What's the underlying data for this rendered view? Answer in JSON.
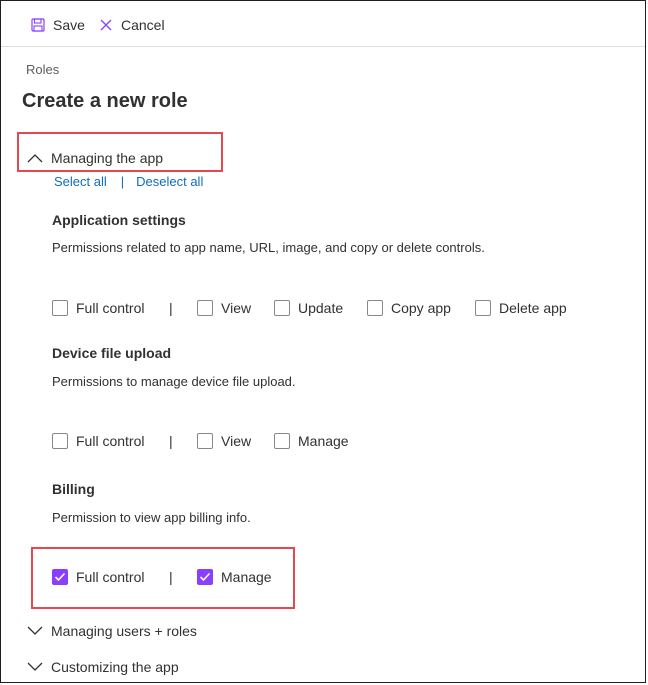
{
  "toolbar": {
    "save_label": "Save",
    "cancel_label": "Cancel",
    "icon_color": "#8a3ffc"
  },
  "breadcrumb": "Roles",
  "page_title": "Create a new role",
  "sections": [
    {
      "label": "Managing the app",
      "expanded": true
    },
    {
      "label": "Managing users + roles",
      "expanded": false
    },
    {
      "label": "Customizing the app",
      "expanded": false
    }
  ],
  "select_all": "Select all",
  "deselect_all": "Deselect all",
  "link_separator": "|",
  "groups": [
    {
      "title": "Application settings",
      "description": "Permissions related to app name, URL, image, and copy or delete controls.",
      "options": [
        {
          "label": "Full control",
          "checked": false
        },
        {
          "label": "View",
          "checked": false
        },
        {
          "label": "Update",
          "checked": false
        },
        {
          "label": "Copy app",
          "checked": false
        },
        {
          "label": "Delete app",
          "checked": false
        }
      ]
    },
    {
      "title": "Device file upload",
      "description": "Permissions to manage device file upload.",
      "options": [
        {
          "label": "Full control",
          "checked": false
        },
        {
          "label": "View",
          "checked": false
        },
        {
          "label": "Manage",
          "checked": false
        }
      ]
    },
    {
      "title": "Billing",
      "description": "Permission to view app billing info.",
      "options": [
        {
          "label": "Full control",
          "checked": true
        },
        {
          "label": "Manage",
          "checked": true
        }
      ]
    }
  ],
  "separator": "|",
  "colors": {
    "accent": "#8a3ffc",
    "link": "#0f6cbd",
    "highlight": "#e5484d"
  }
}
